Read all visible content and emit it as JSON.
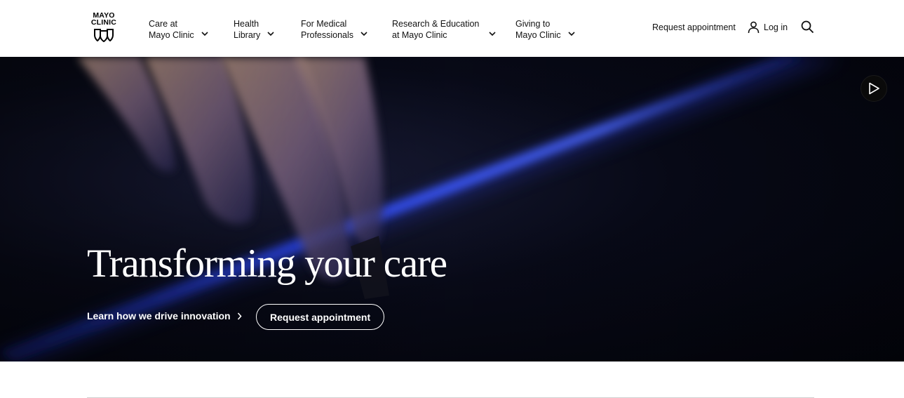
{
  "header": {
    "logo": {
      "line1": "MAYO",
      "line2": "CLINIC",
      "icon": "mayo-shields-icon"
    },
    "nav": [
      {
        "label": "Care at\nMayo Clinic",
        "icon": "chevron-down-icon"
      },
      {
        "label": "Health\nLibrary",
        "icon": "chevron-down-icon"
      },
      {
        "label": "For Medical\nProfessionals",
        "icon": "chevron-down-icon"
      },
      {
        "label": "Research & Education\nat Mayo Clinic",
        "icon": "chevron-down-icon"
      },
      {
        "label": "Giving to\nMayo Clinic",
        "icon": "chevron-down-icon"
      }
    ],
    "request_appointment": "Request appointment",
    "login": {
      "label": "Log in",
      "icon": "user-icon"
    },
    "search": {
      "icon": "search-icon"
    }
  },
  "hero": {
    "title": "Transforming your care",
    "learn_link": {
      "label": "Learn how we drive innovation",
      "icon": "chevron-right-icon"
    },
    "cta_button": "Request appointment",
    "play": {
      "icon": "play-icon"
    }
  },
  "colors": {
    "header_bg": "#ffffff",
    "hero_bg": "#05060f",
    "accent_light": "#3b5bff",
    "text_on_dark": "#ffffff"
  }
}
